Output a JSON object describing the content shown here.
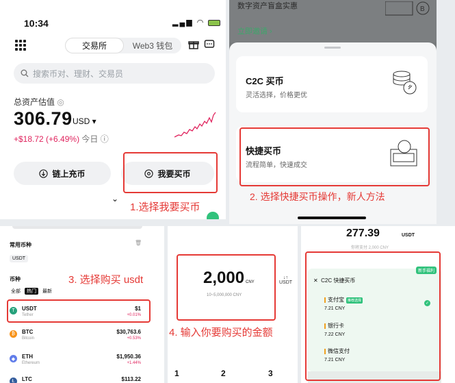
{
  "panel1": {
    "time": "10:34",
    "tabs": [
      "交易所",
      "Web3 钱包"
    ],
    "search_placeholder": "搜索币对、理财、交易员",
    "asset_label": "总资产估值",
    "amount": "306.79",
    "unit": "USD",
    "pnl": "+$18.72 (+6.49%)",
    "pnl_period": "今日",
    "deposit_btn": "链上充币",
    "buy_btn": "我要买币"
  },
  "annotations": {
    "step1": "1.选择我要买币",
    "step2": "2. 选择快捷买币操作，新人方法",
    "step3": "3. 选择购买 usdt",
    "step4": "4. 输入你要购买的金额"
  },
  "panel2": {
    "top_text": "数字资产盲盒实惠",
    "invite": "立即邀请 ›",
    "c2c_title": "C2C 买币",
    "c2c_sub": "灵活选择，价格更优",
    "quick_title": "快捷买币",
    "quick_sub": "流程简单，快速成交"
  },
  "panel3": {
    "common_label": "常用币种",
    "common_chip": "USDT",
    "coin_label": "币种",
    "filters": [
      "全部",
      "热门",
      "最新"
    ],
    "coins": [
      {
        "sym": "USDT",
        "name": "Tether",
        "price": "$1",
        "chg": "+0.01%",
        "color": "#26a17b",
        "icon": "T"
      },
      {
        "sym": "BTC",
        "name": "Bitcoin",
        "price": "$30,763.6",
        "chg": "+0.53%",
        "color": "#f7931a",
        "icon": "₿"
      },
      {
        "sym": "ETH",
        "name": "Ethereum",
        "price": "$1,950.36",
        "chg": "+1.44%",
        "color": "#627eea",
        "icon": "◆"
      },
      {
        "sym": "LTC",
        "name": "",
        "price": "$113.22",
        "chg": "",
        "color": "#345d9d",
        "icon": "Ł"
      }
    ]
  },
  "panel4": {
    "amount": "2,000",
    "unit": "CNY",
    "range": "10~5,000,000 CNY",
    "swap_label": "USDT",
    "keys": [
      "1",
      "2",
      "3"
    ]
  },
  "panel5": {
    "amount": "277.39",
    "unit": "USDT",
    "sub": "你将支付 2,000 CNY",
    "badge": "新手福利",
    "head": "C2C 快捷买币",
    "methods": [
      {
        "name": "支付宝",
        "price": "7.21 CNY",
        "recommended": "推荐选择"
      },
      {
        "name": "银行卡",
        "price": "7.22 CNY",
        "recommended": ""
      },
      {
        "name": "微信支付",
        "price": "7.21 CNY",
        "recommended": ""
      }
    ]
  }
}
